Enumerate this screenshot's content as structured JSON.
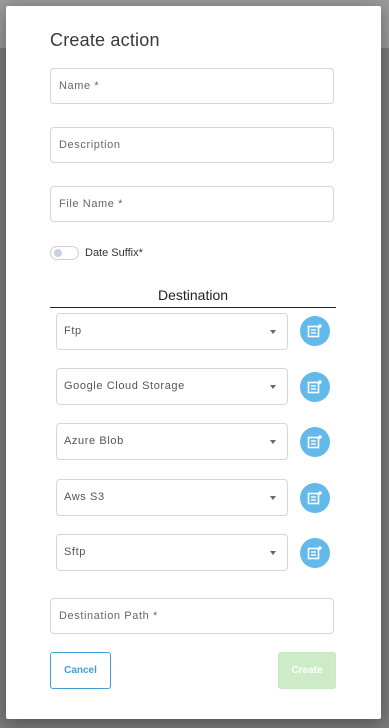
{
  "dialog": {
    "title": "Create action",
    "name_placeholder": "Name *",
    "description_placeholder": "Description",
    "file_name_placeholder": "File Name *",
    "date_suffix_label": "Date Suffix*",
    "date_suffix_on": false,
    "destination_title": "Destination",
    "destinations": [
      {
        "label": "Ftp"
      },
      {
        "label": "Google Cloud Storage"
      },
      {
        "label": "Azure Blob"
      },
      {
        "label": "Aws S3"
      },
      {
        "label": "Sftp"
      }
    ],
    "destination_path_placeholder": "Destination Path *",
    "cancel_label": "Cancel",
    "create_label": "Create"
  },
  "colors": {
    "accent": "#3fa0d8",
    "icon_button": "#63b9ea",
    "create_disabled": "#cdebc6"
  },
  "icons": {
    "destination_action": "add-config-icon",
    "select_arrow": "chevron-down-icon"
  }
}
